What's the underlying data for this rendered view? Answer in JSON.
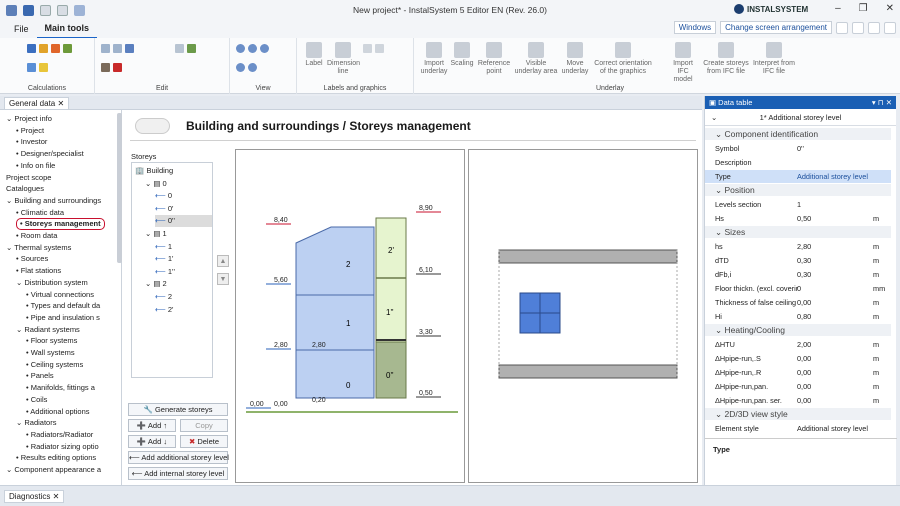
{
  "window": {
    "title": "New project* - InstalSystem 5 Editor EN (Rev. 26.0)",
    "brand": "INSTALSYSTEM",
    "windows_btn": "Windows",
    "arrangement_btn": "Change screen arrangement"
  },
  "menu": {
    "file": "File",
    "main_tools": "Main tools"
  },
  "ribbon": {
    "groups": [
      "Calculations",
      "Edit",
      "View",
      "Labels and graphics",
      "Underlay"
    ],
    "buttons": [
      "Label",
      "Dimension line",
      "Import underlay",
      "Scaling",
      "Reference point",
      "Visible underlay area",
      "Move underlay",
      "Correct orientation of the graphics",
      "Import IFC model",
      "Create storeys from IFC file",
      "Interpret from IFC file"
    ]
  },
  "doc_tab": "General data",
  "tree": [
    {
      "label": "Project info",
      "level": 0,
      "exp": "open"
    },
    {
      "label": "Project",
      "level": 1
    },
    {
      "label": "Investor",
      "level": 1
    },
    {
      "label": "Designer/specialist",
      "level": 1
    },
    {
      "label": "Info on file",
      "level": 1
    },
    {
      "label": "Project scope",
      "level": 0
    },
    {
      "label": "Catalogues",
      "level": 0
    },
    {
      "label": "Building and surroundings",
      "level": 0,
      "exp": "open"
    },
    {
      "label": "Climatic data",
      "level": 1
    },
    {
      "label": "Storeys management",
      "level": 1,
      "sel": true
    },
    {
      "label": "Room data",
      "level": 1
    },
    {
      "label": "Thermal systems",
      "level": 0,
      "exp": "open"
    },
    {
      "label": "Sources",
      "level": 1
    },
    {
      "label": "Flat stations",
      "level": 1
    },
    {
      "label": "Distribution system",
      "level": 1,
      "exp": "open"
    },
    {
      "label": "Virtual connections",
      "level": 2
    },
    {
      "label": "Types and default da",
      "level": 2
    },
    {
      "label": "Pipe and insulation s",
      "level": 2
    },
    {
      "label": "Radiant systems",
      "level": 1,
      "exp": "open"
    },
    {
      "label": "Floor systems",
      "level": 2
    },
    {
      "label": "Wall systems",
      "level": 2
    },
    {
      "label": "Ceiling systems",
      "level": 2
    },
    {
      "label": "Panels",
      "level": 2
    },
    {
      "label": "Manifolds, fittings a",
      "level": 2
    },
    {
      "label": "Coils",
      "level": 2
    },
    {
      "label": "Additional options",
      "level": 2
    },
    {
      "label": "Radiators",
      "level": 1,
      "exp": "open"
    },
    {
      "label": "Radiators/Radiator",
      "level": 2
    },
    {
      "label": "Radiator sizing optio",
      "level": 2
    },
    {
      "label": "Results editing options",
      "level": 1
    },
    {
      "label": "Component appearance a",
      "level": 0,
      "exp": "open"
    }
  ],
  "main": {
    "title": "Building and surroundings / Storeys management",
    "storeys_label": "Storeys",
    "storeys": [
      {
        "label": "Building",
        "indent": 0,
        "icon": "building"
      },
      {
        "label": "0",
        "indent": 1,
        "icon": "storey"
      },
      {
        "label": "0",
        "indent": 2,
        "icon": "level"
      },
      {
        "label": "0'",
        "indent": 2,
        "icon": "level"
      },
      {
        "label": "0''",
        "indent": 2,
        "icon": "level",
        "sel": true
      },
      {
        "label": "1",
        "indent": 1,
        "icon": "storey"
      },
      {
        "label": "1",
        "indent": 2,
        "icon": "level"
      },
      {
        "label": "1'",
        "indent": 2,
        "icon": "level"
      },
      {
        "label": "1''",
        "indent": 2,
        "icon": "level"
      },
      {
        "label": "2",
        "indent": 1,
        "icon": "storey"
      },
      {
        "label": "2",
        "indent": 2,
        "icon": "level"
      },
      {
        "label": "2'",
        "indent": 2,
        "icon": "level"
      }
    ],
    "buttons": {
      "generate": "Generate storeys",
      "add1": "Add",
      "copy": "Copy",
      "add2": "Add",
      "delete": "Delete",
      "add_additional": "Add additional storey level",
      "add_internal": "Add internal storey level"
    },
    "section": {
      "storey_labels": [
        "2",
        "1",
        "0",
        "2'",
        "1''",
        "0''"
      ],
      "elevations": [
        "8,40",
        "8,90",
        "5,60",
        "6,10",
        "2,80",
        "2,80",
        "3,30",
        "0,00",
        "0,00",
        "0,20",
        "0,50"
      ]
    }
  },
  "props": {
    "header": "Data table",
    "subtitle": "1* Additional storey level",
    "rows": [
      {
        "t": "cat",
        "k": "Component identification"
      },
      {
        "k": "Symbol",
        "v": "0''"
      },
      {
        "k": "Description",
        "v": ""
      },
      {
        "k": "Type",
        "v": "Additional storey level",
        "hl": true
      },
      {
        "t": "cat",
        "k": "Position"
      },
      {
        "k": "Levels section",
        "v": "1"
      },
      {
        "k": "Hs",
        "v": "0,50",
        "u": "m"
      },
      {
        "t": "cat",
        "k": "Sizes"
      },
      {
        "k": "hs",
        "v": "2,80",
        "u": "m"
      },
      {
        "k": "dTD",
        "v": "0,30",
        "u": "m"
      },
      {
        "k": "dFb,i",
        "v": "0,30",
        "u": "m"
      },
      {
        "k": "Floor thickn. (excl. coverir",
        "v": "0",
        "u": "mm"
      },
      {
        "k": "Thickness of false ceiling",
        "v": "0,00",
        "u": "m"
      },
      {
        "k": "Hi",
        "v": "0,80",
        "u": "m"
      },
      {
        "t": "cat",
        "k": "Heating/Cooling"
      },
      {
        "k": "ΔHTU",
        "v": "2,00",
        "u": "m"
      },
      {
        "k": "ΔHpipe-run,.S",
        "v": "0,00",
        "u": "m"
      },
      {
        "k": "ΔHpipe-run,.R",
        "v": "0,00",
        "u": "m"
      },
      {
        "k": "ΔHpipe-run,pan.",
        "v": "0,00",
        "u": "m"
      },
      {
        "k": "ΔHpipe-run,pan. ser.",
        "v": "0,00",
        "u": "m"
      },
      {
        "t": "cat",
        "k": "2D/3D view style"
      },
      {
        "k": "Element style",
        "v": "Additional storey level"
      }
    ],
    "description": "Type"
  },
  "status": {
    "tab": "Diagnostics"
  }
}
